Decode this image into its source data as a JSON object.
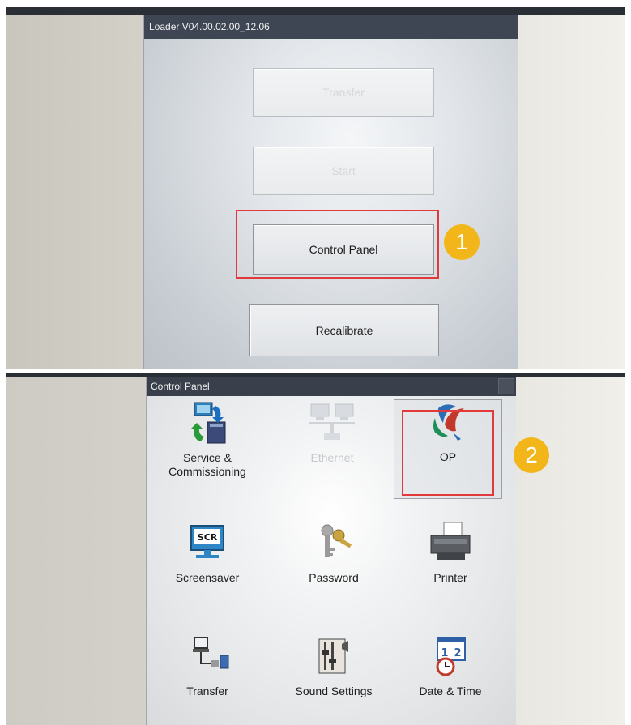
{
  "loader": {
    "title": "Loader V04.00.02.00_12.06",
    "buttons": {
      "transfer": "Transfer",
      "start": "Start",
      "control_panel": "Control Panel",
      "recalibrate": "Recalibrate"
    },
    "step_badge": "1"
  },
  "control_panel": {
    "title": "Control Panel",
    "step_badge": "2",
    "items": [
      {
        "label_line1": "Service &",
        "label_line2": "Commissioning",
        "icon": "service-commissioning-icon"
      },
      {
        "label_line1": "Ethernet",
        "label_line2": "",
        "icon": "ethernet-icon"
      },
      {
        "label_line1": "OP",
        "label_line2": "",
        "icon": "op-icon"
      },
      {
        "label_line1": "Screensaver",
        "label_line2": "",
        "icon": "screensaver-icon",
        "icon_text": "SCR"
      },
      {
        "label_line1": "Password",
        "label_line2": "",
        "icon": "password-keys-icon"
      },
      {
        "label_line1": "Printer",
        "label_line2": "",
        "icon": "printer-icon"
      },
      {
        "label_line1": "Transfer",
        "label_line2": "",
        "icon": "transfer-icon"
      },
      {
        "label_line1": "Sound Settings",
        "label_line2": "",
        "icon": "sound-settings-icon"
      },
      {
        "label_line1": "Date & Time",
        "label_line2": "",
        "icon": "date-time-icon",
        "icon_text_1": "1",
        "icon_text_2": "2"
      }
    ]
  },
  "colors": {
    "highlight": "#e23a3a",
    "badge": "#f2b61b",
    "titlebar": "#3e4654"
  }
}
